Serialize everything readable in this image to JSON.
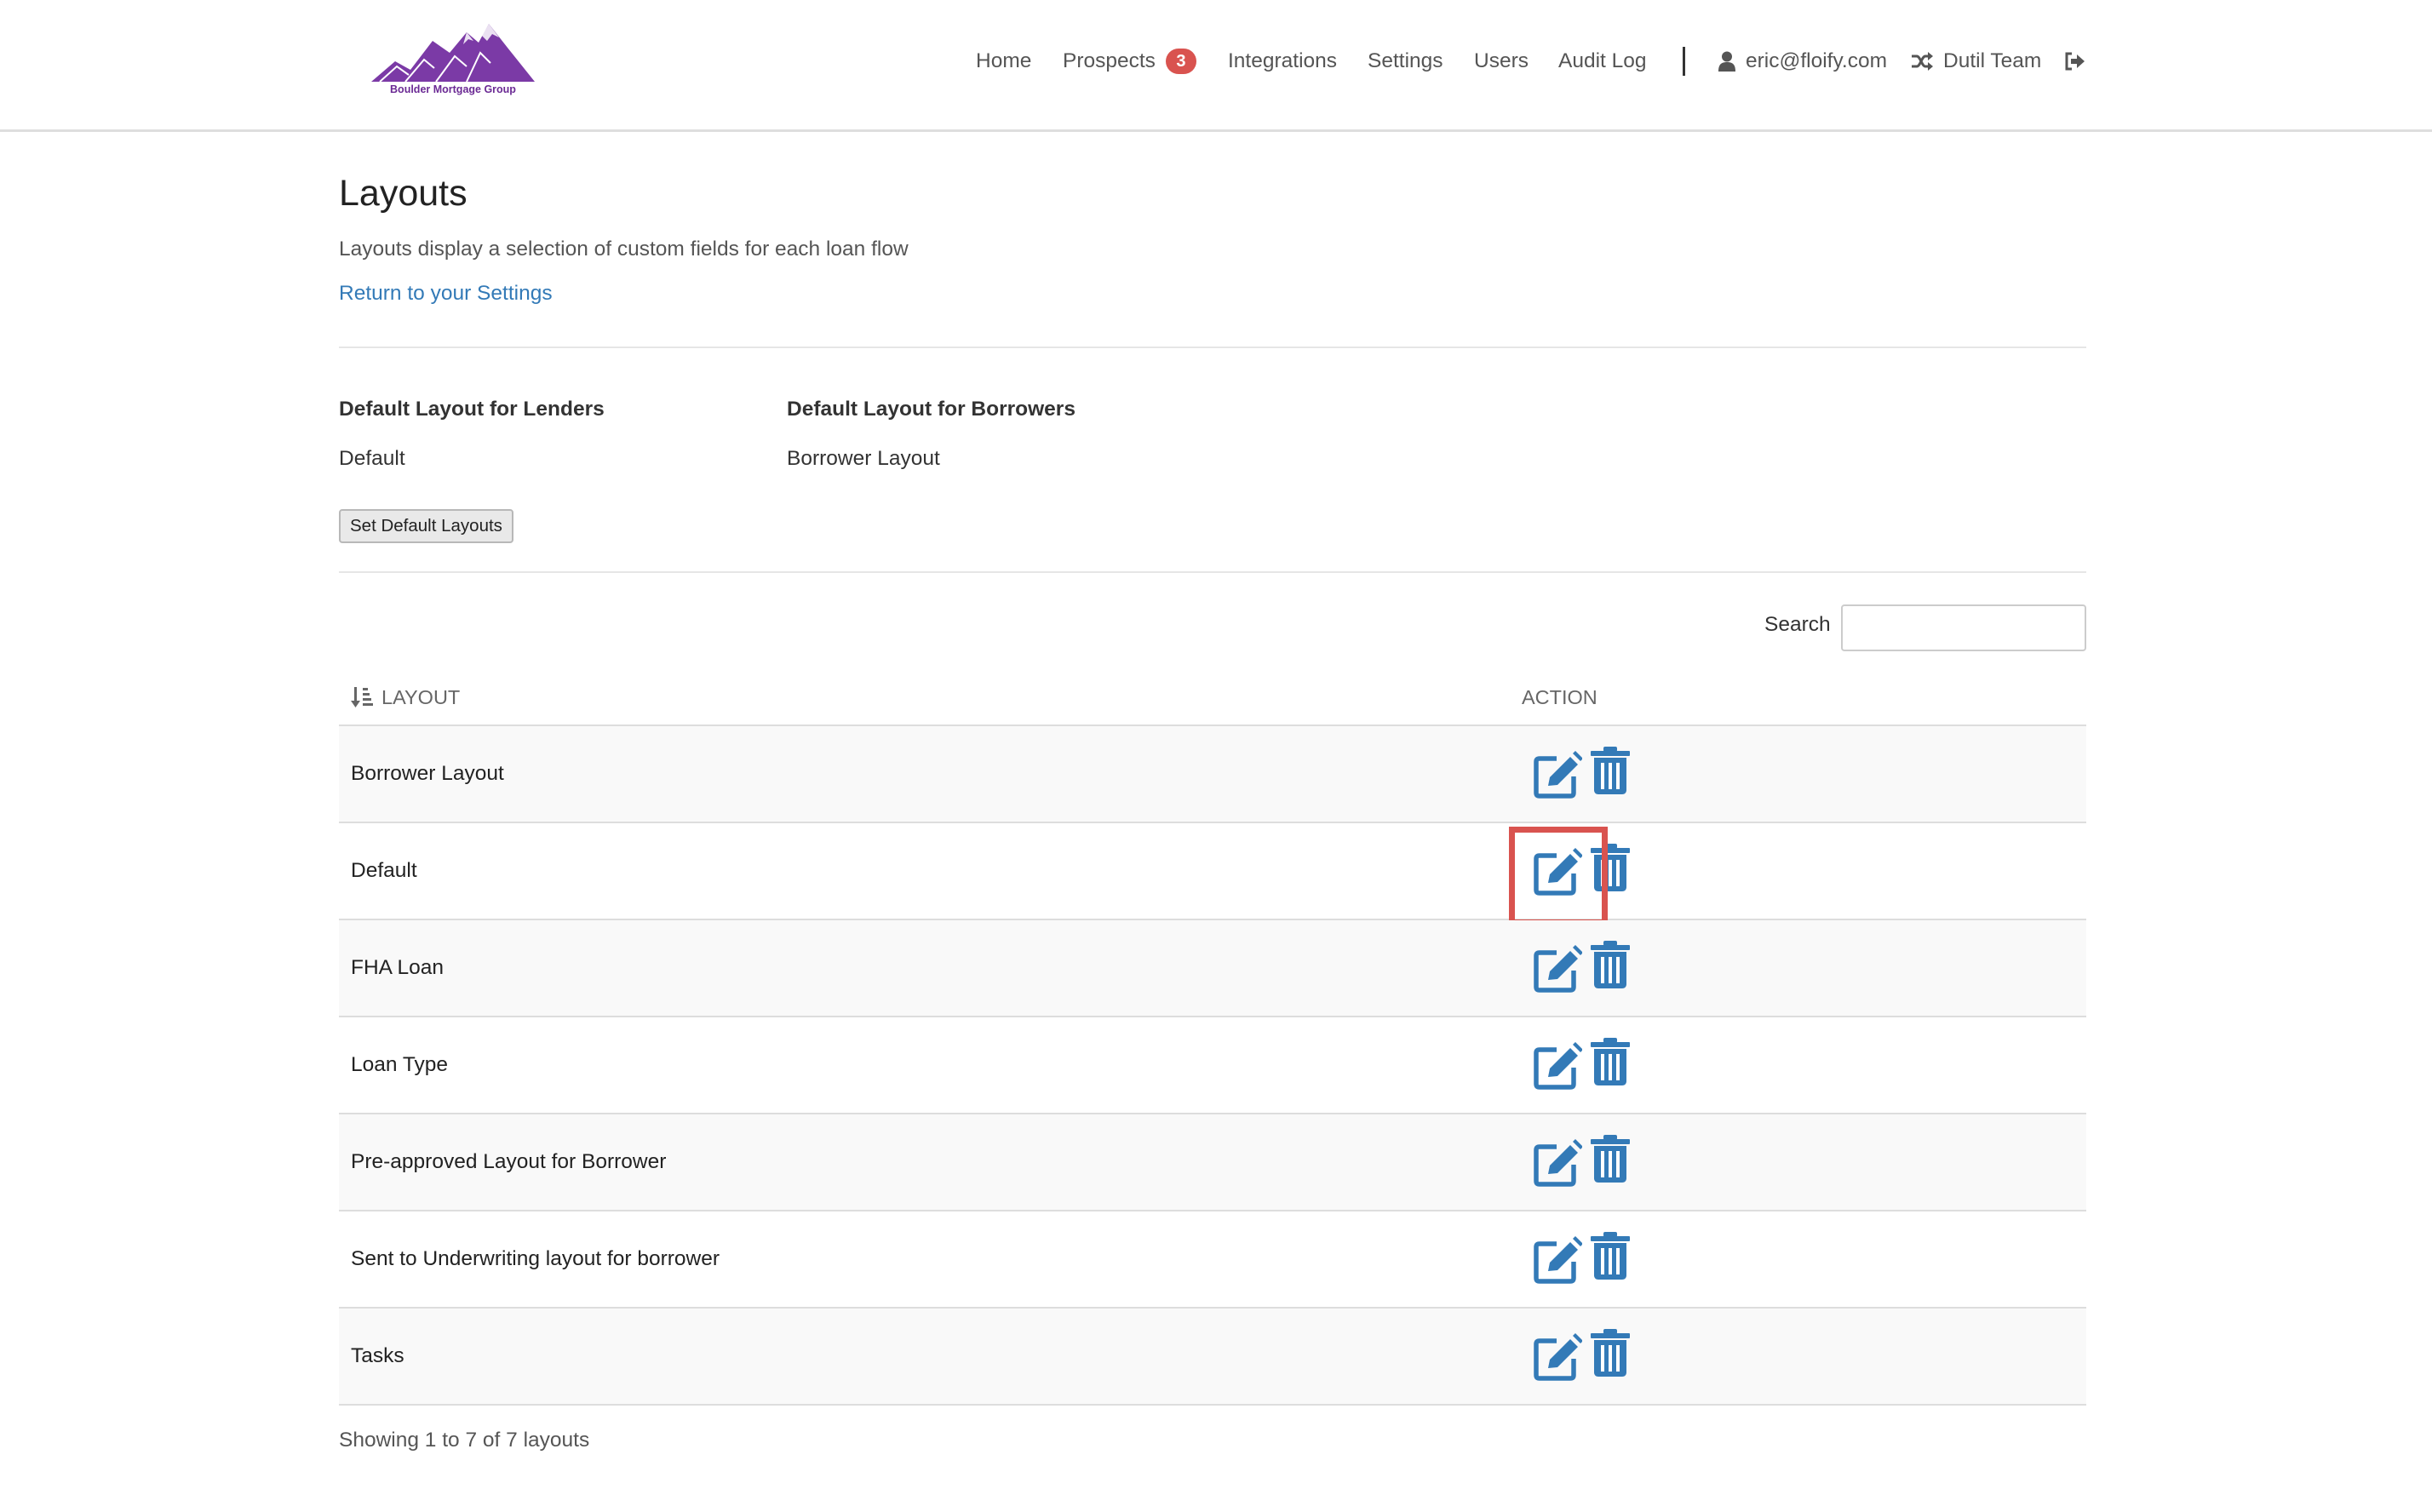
{
  "brand": {
    "logo_text": "Boulder Mortgage Group",
    "color": "#6b2a94"
  },
  "nav": {
    "home": "Home",
    "prospects": "Prospects",
    "prospects_badge": "3",
    "integrations": "Integrations",
    "settings": "Settings",
    "users": "Users",
    "audit_log": "Audit Log",
    "user_email": "eric@floify.com",
    "team": "Dutil Team"
  },
  "page": {
    "title": "Layouts",
    "subtitle": "Layouts display a selection of custom fields for each loan flow",
    "return_link": "Return to your Settings"
  },
  "defaults": {
    "lenders_label": "Default Layout for Lenders",
    "lenders_value": "Default",
    "borrowers_label": "Default Layout for Borrowers",
    "borrowers_value": "Borrower Layout",
    "button": "Set Default Layouts"
  },
  "search": {
    "label": "Search",
    "value": ""
  },
  "table": {
    "headers": {
      "layout": "LAYOUT",
      "action": "ACTION"
    },
    "rows": [
      {
        "name": "Borrower Layout"
      },
      {
        "name": "Default"
      },
      {
        "name": "FHA Loan"
      },
      {
        "name": "Loan Type"
      },
      {
        "name": "Pre-approved Layout for Borrower"
      },
      {
        "name": "Sent to Underwriting layout for borrower"
      },
      {
        "name": "Tasks"
      }
    ],
    "highlighted_row": 1,
    "action_icons": [
      "edit-icon",
      "trash-icon"
    ],
    "icon_color": "#337ab7",
    "highlight_color": "#d9534f"
  },
  "footer": {
    "count_text": "Showing 1 to 7 of 7 layouts"
  }
}
